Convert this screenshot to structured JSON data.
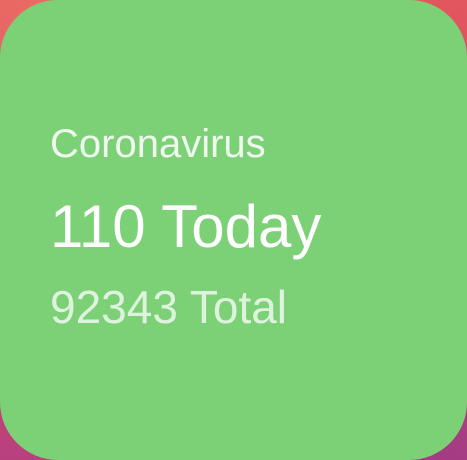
{
  "widget": {
    "title": "Coronavirus",
    "today_label": "110 Today",
    "total_label": "92343 Total",
    "background_color": "#7cd177",
    "text_color": "#ffffff"
  },
  "wallpaper": {
    "colors": [
      "#e2565e",
      "#d24b6a",
      "#b9407f"
    ]
  }
}
